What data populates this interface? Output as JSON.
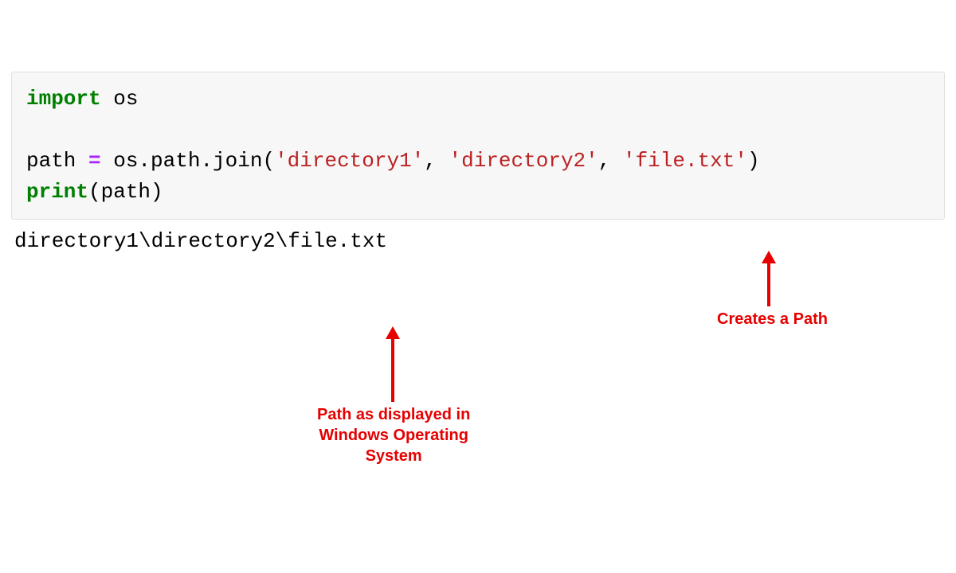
{
  "code": {
    "line1": {
      "keyword": "import",
      "module": " os"
    },
    "line2": "",
    "line3": {
      "var": "path ",
      "eq": "=",
      "call_prefix": " os.path.join(",
      "str1": "'directory1'",
      "comma1": ", ",
      "str2": "'directory2'",
      "comma2": ", ",
      "str3": "'file.txt'",
      "close": ")"
    },
    "line4": {
      "func": "print",
      "open": "(path)"
    }
  },
  "output": "directory1\\directory2\\file.txt",
  "annotations": {
    "creates_path": "Creates a Path",
    "windows_path": "Path as displayed in\nWindows Operating\nSystem"
  }
}
